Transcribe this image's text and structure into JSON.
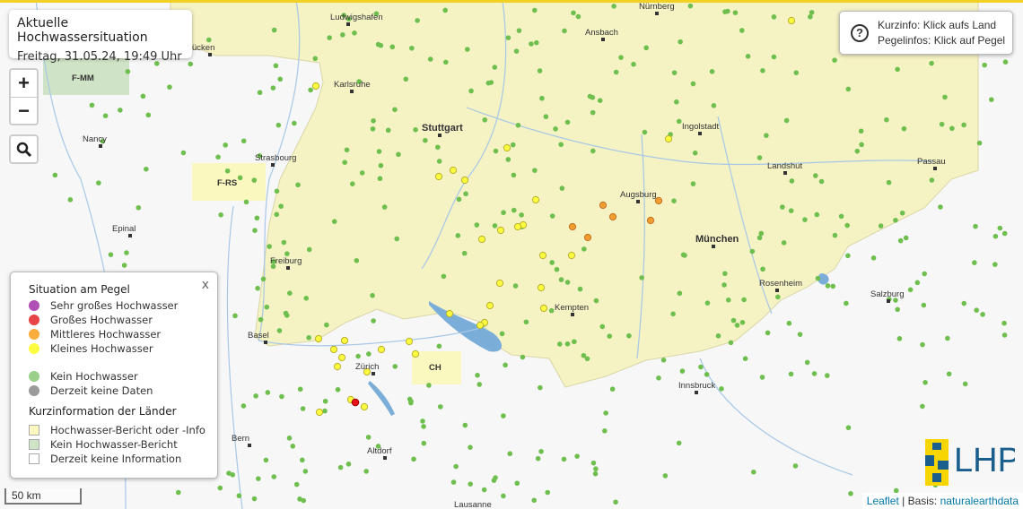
{
  "title": {
    "heading": "Aktuelle Hochwassersituation",
    "datetime": "Freitag, 31.05.24, 19:49 Uhr"
  },
  "controls": {
    "zoom_in": "+",
    "zoom_out": "−",
    "search_icon": "search-icon"
  },
  "info": {
    "line1": "Kurzinfo: Klick aufs Land",
    "line2": "Pegelinfos: Klick auf Pegel"
  },
  "legend": {
    "close": "x",
    "section1": "Situation am Pegel",
    "levels": [
      {
        "label": "Sehr großes Hochwasser",
        "color": "#b04fb5"
      },
      {
        "label": "Großes Hochwasser",
        "color": "#e84448"
      },
      {
        "label": "Mittleres Hochwasser",
        "color": "#f8ad3c"
      },
      {
        "label": "Kleines Hochwasser",
        "color": "#fdfb3f"
      },
      {
        "label": "Kein Hochwasser",
        "color": "#9bcf8a"
      },
      {
        "label": "Derzeit keine Daten",
        "color": "#9a9a9a"
      }
    ],
    "section2": "Kurzinformation der Länder",
    "regions": [
      {
        "label": "Hochwasser-Bericht oder -Info",
        "color": "#fbf8bf"
      },
      {
        "label": "Kein Hochwasser-Bericht",
        "color": "#cfe3c6"
      },
      {
        "label": "Derzeit keine Information",
        "color": "#ffffff"
      }
    ]
  },
  "regions": {
    "fmm": "F-MM",
    "frs": "F-RS",
    "ch": "CH"
  },
  "cities": [
    "Ludwigshafen",
    "Nürnberg",
    "Ansbach",
    "Karlsruhe",
    "Stuttgart",
    "Ingolstadt",
    "Strasbourg",
    "Landshut",
    "Passau",
    "Augsburg",
    "München",
    "Freiburg",
    "Rosenheim",
    "Salzburg",
    "Kempten",
    "Basel",
    "Zürich",
    "Innsbruck",
    "Bern",
    "Altdorf",
    "Nancy",
    "Epinal",
    "ücken",
    "Lausanne"
  ],
  "scale": "50 km",
  "attribution": {
    "leaflet": "Leaflet",
    "sep": " | Basis: ",
    "source": "naturalearthdata"
  },
  "logo": "LHP"
}
